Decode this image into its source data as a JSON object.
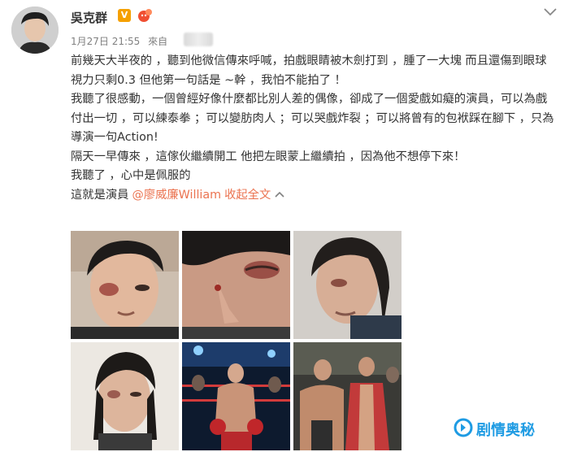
{
  "user": {
    "name": "吳克群",
    "verified_badge": "V"
  },
  "meta": {
    "timestamp": "1月27日 21:55",
    "source_prefix": "來自"
  },
  "post": {
    "paragraphs": [
      "前幾天大半夜的 ，聽到他微信傳來呼喊，拍戲眼睛被木劍打到 ，腫了一大塊 而且還傷到眼球 視力只剩0.3 但他第一句話是 ~幹 ，我怕不能拍了 ！",
      "我聽了很感動，一個曾經好像什麼都比別人差的偶像，卻成了一個愛戲如癡的演員，可以為戲付出一切 ，可以練泰拳 ；可以變肪肉人 ；可以哭戲炸裂 ；可以將曾有的包袱踩在腳下 ，只為導演一句Action!",
      "隔天一早傳來 ，這傢伙繼續開工 他把左眼蒙上繼續拍 ，因為他不想停下來！",
      "我聽了 ，心中是佩服的"
    ],
    "last_line_text": "這就是演員",
    "mention": "@廖威廉William",
    "collapse_label": "收起全文"
  },
  "photos": [
    {
      "name": "photo-swollen-eye-selfie"
    },
    {
      "name": "photo-eye-closeup"
    },
    {
      "name": "photo-costume-side"
    },
    {
      "name": "photo-long-hair-front"
    },
    {
      "name": "photo-boxing-ring"
    },
    {
      "name": "photo-muscular-scene"
    }
  ],
  "watermark": {
    "text": "剧情奥秘"
  },
  "colors": {
    "link": "#eb7350",
    "meta": "#808080",
    "watermark": "#1e9be3",
    "verified": "#f5a000"
  }
}
